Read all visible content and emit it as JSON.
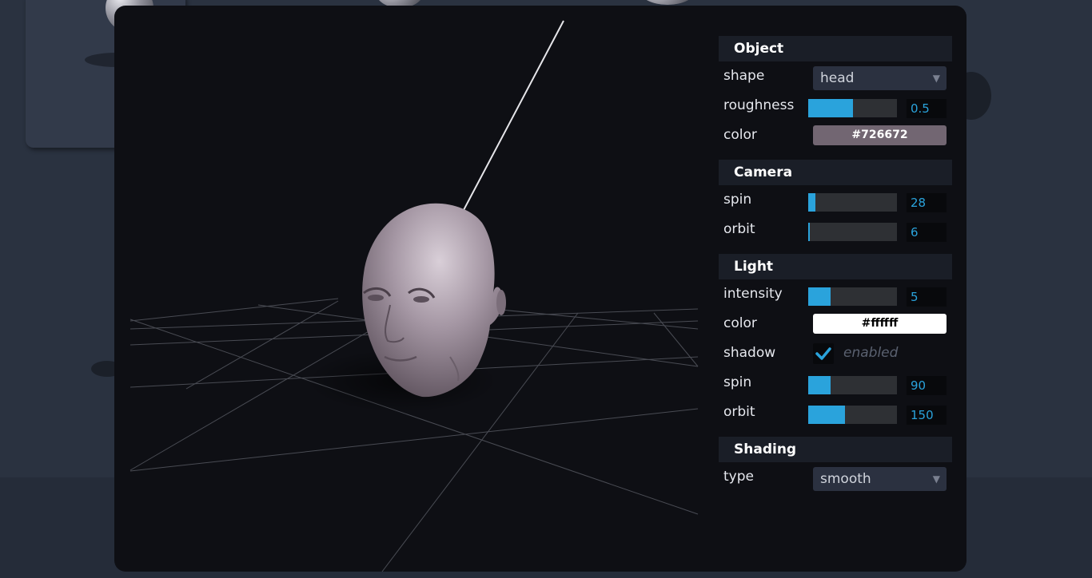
{
  "colors": {
    "accent": "#2aa3dc",
    "object_color": "#726672",
    "light_color": "#ffffff"
  },
  "panel": {
    "object": {
      "title": "Object",
      "shape_label": "shape",
      "shape_value": "head",
      "roughness_label": "roughness",
      "roughness_value": "0.5",
      "roughness_fraction": 0.5,
      "color_label": "color",
      "color_value": "#726672"
    },
    "camera": {
      "title": "Camera",
      "spin_label": "spin",
      "spin_value": "28",
      "spin_fraction": 0.078,
      "orbit_label": "orbit",
      "orbit_value": "6",
      "orbit_fraction": 0.017
    },
    "light": {
      "title": "Light",
      "intensity_label": "intensity",
      "intensity_value": "5",
      "intensity_fraction": 0.25,
      "color_label": "color",
      "color_value": "#ffffff",
      "shadow_label": "shadow",
      "shadow_checked": true,
      "shadow_text": "enabled",
      "spin_label": "spin",
      "spin_value": "90",
      "spin_fraction": 0.25,
      "orbit_label": "orbit",
      "orbit_value": "150",
      "orbit_fraction": 0.417
    },
    "shading": {
      "title": "Shading",
      "type_label": "type",
      "type_value": "smooth"
    }
  }
}
